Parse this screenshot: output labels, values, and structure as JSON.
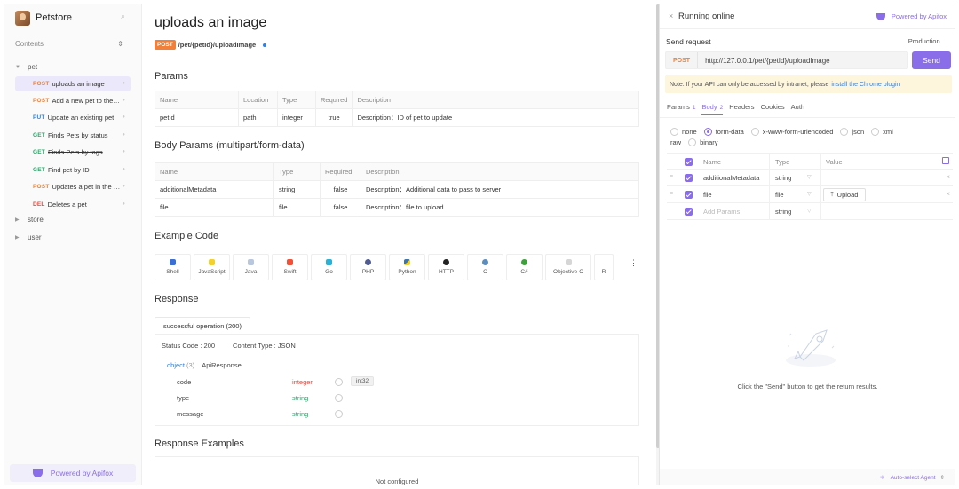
{
  "sidebar": {
    "title": "Petstore",
    "contents_label": "Contents",
    "folders": {
      "pet": "pet",
      "store": "store",
      "user": "user"
    },
    "items": [
      {
        "method": "POST",
        "label": "uploads an image",
        "active": true
      },
      {
        "method": "POST",
        "label": "Add a new pet to the store"
      },
      {
        "method": "PUT",
        "label": "Update an existing pet"
      },
      {
        "method": "GET",
        "label": "Finds Pets by status"
      },
      {
        "method": "GET",
        "label": "Finds Pets by tags",
        "strike": true
      },
      {
        "method": "GET",
        "label": "Find pet by ID"
      },
      {
        "method": "POST",
        "label": "Updates a pet in the store"
      },
      {
        "method": "DEL",
        "label": "Deletes a pet"
      }
    ],
    "footer": "Powered by Apifox"
  },
  "main": {
    "title": "uploads an image",
    "method": "POST",
    "path": "/pet/{petId}/uploadImage",
    "params_title": "Params",
    "params_headers": [
      "Name",
      "Location",
      "Type",
      "Required",
      "Description"
    ],
    "params_rows": [
      {
        "name": "petId",
        "location": "path",
        "type": "integer",
        "required": "true",
        "description": "Description：ID of pet to update"
      }
    ],
    "body_title": "Body Params (multipart/form-data)",
    "body_headers": [
      "Name",
      "Type",
      "Required",
      "Description"
    ],
    "body_rows": [
      {
        "name": "additionalMetadata",
        "type": "string",
        "required": "false",
        "description": "Description：Additional data to pass to server"
      },
      {
        "name": "file",
        "type": "file",
        "required": "false",
        "description": "Description：file to upload"
      }
    ],
    "example_title": "Example Code",
    "code_tabs": [
      "Shell",
      "JavaScript",
      "Java",
      "Swift",
      "Go",
      "PHP",
      "Python",
      "HTTP",
      "C",
      "C#",
      "Objective-C",
      "R"
    ],
    "code_more": "⋮",
    "response_title": "Response",
    "response_tab": "successful operation (200)",
    "status_code": "Status Code : 200",
    "content_type": "Content Type : JSON",
    "schema_object": "object",
    "schema_count": "(3)",
    "schema_ref": "ApiResponse",
    "schema_fields": [
      {
        "name": "code",
        "type": "integer",
        "format": "int32"
      },
      {
        "name": "type",
        "type": "string"
      },
      {
        "name": "message",
        "type": "string"
      }
    ],
    "examples_title": "Response Examples",
    "not_configured": "Not configured"
  },
  "run": {
    "close": "×",
    "title": "Running online",
    "powered": "Powered by Apifox",
    "send_request": "Send request",
    "env": "Production ...",
    "method": "POST",
    "url": "http://127.0.0.1/pet/{petId}/uploadImage",
    "send": "Send",
    "note": "Note: If your API can only be accessed by intranet, please",
    "note_link": "install the Chrome plugin",
    "tabs": [
      {
        "label": "Params",
        "count": "1"
      },
      {
        "label": "Body",
        "count": "2",
        "active": true
      },
      {
        "label": "Headers",
        "count": ""
      },
      {
        "label": "Cookies",
        "count": ""
      },
      {
        "label": "Auth",
        "count": ""
      }
    ],
    "body_types_row1": [
      "none",
      "form-data",
      "x-www-form-urlencoded",
      "json",
      "xml"
    ],
    "body_types_row2": [
      "raw",
      "binary"
    ],
    "selected_body_type": "form-data",
    "table_headers": {
      "name": "Name",
      "type": "Type",
      "value": "Value"
    },
    "rows": [
      {
        "name": "additionalMetadata",
        "type": "string"
      },
      {
        "name": "file",
        "type": "file",
        "upload": "Upload"
      }
    ],
    "add_placeholder": "Add Params",
    "add_type": "string",
    "empty_msg": "Click the \"Send\" button to get the return results.",
    "agent": "Auto-select Agent"
  },
  "colors": {
    "accent": "#8a6de8",
    "post": "#f0803a",
    "get": "#28a86b",
    "put": "#3080e0",
    "del": "#e8483c"
  }
}
